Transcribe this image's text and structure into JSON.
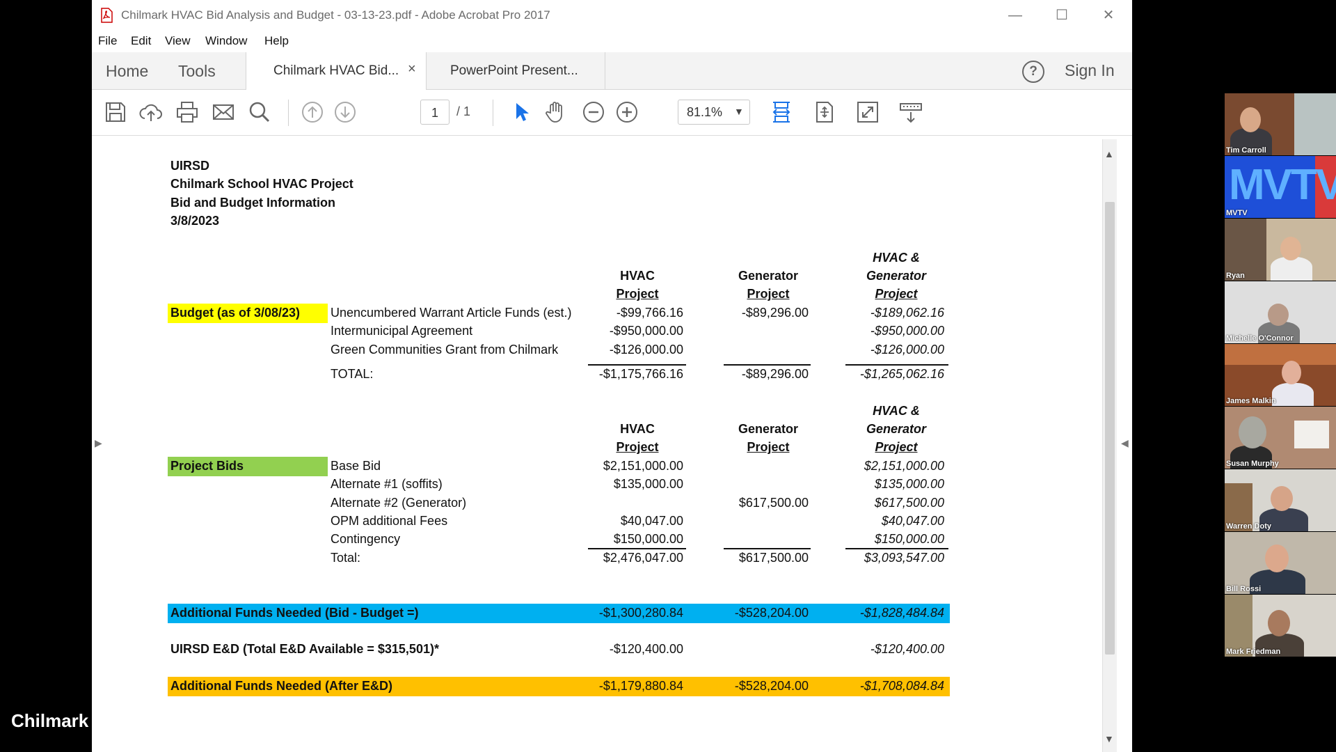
{
  "window": {
    "title": "Chilmark HVAC Bid Analysis and Budget - 03-13-23.pdf - Adobe Acrobat Pro 2017",
    "minimize": "—",
    "maximize": "☐",
    "close": "✕"
  },
  "menu": [
    "File",
    "Edit",
    "View",
    "Window",
    "Help"
  ],
  "tabs": {
    "home": "Home",
    "tools": "Tools",
    "active_doc": "Chilmark HVAC Bid...",
    "close": "×",
    "other_doc": "PowerPoint Present...",
    "help": "?",
    "sign_in": "Sign In"
  },
  "toolbar": {
    "page_current": "1",
    "page_total": "/ 1",
    "zoom": "81.1%",
    "icons": [
      "save-icon",
      "upload-icon",
      "print-icon",
      "email-icon",
      "search-icon",
      "page-up-icon",
      "page-down-icon",
      "select-arrow-icon",
      "hand-icon",
      "zoom-out-icon",
      "zoom-in-icon",
      "fit-width-icon",
      "fit-page-icon",
      "fullscreen-icon",
      "read-mode-icon"
    ]
  },
  "document": {
    "header": [
      "UIRSD",
      "Chilmark School HVAC Project",
      "Bid and Budget Information",
      "3/8/2023"
    ],
    "col_headers": {
      "hvac": [
        "HVAC",
        "Project"
      ],
      "generator": [
        "Generator",
        "Project"
      ],
      "combined": [
        "HVAC &",
        "Generator",
        "Project"
      ]
    },
    "budget": {
      "label": "Budget (as of 3/08/23)",
      "label_color": "#ffff00",
      "rows": [
        {
          "item": "Unencumbered Warrant Article Funds (est.)",
          "hvac": "-$99,766.16",
          "gen": "-$89,296.00",
          "combined": "-$189,062.16"
        },
        {
          "item": "Intermunicipal Agreement",
          "hvac": "-$950,000.00",
          "gen": "",
          "combined": "-$950,000.00"
        },
        {
          "item": "Green Communities Grant from Chilmark",
          "hvac": "-$126,000.00",
          "gen": "",
          "combined": "-$126,000.00"
        }
      ],
      "total": {
        "item": "TOTAL:",
        "hvac": "-$1,175,766.16",
        "gen": "-$89,296.00",
        "combined": "-$1,265,062.16"
      }
    },
    "bids": {
      "label": "Project Bids",
      "label_color": "#92d050",
      "rows": [
        {
          "item": "Base Bid",
          "hvac": "$2,151,000.00",
          "gen": "",
          "combined": "$2,151,000.00"
        },
        {
          "item": "Alternate #1 (soffits)",
          "hvac": "$135,000.00",
          "gen": "",
          "combined": "$135,000.00"
        },
        {
          "item": "Alternate #2 (Generator)",
          "hvac": "",
          "gen": "$617,500.00",
          "combined": "$617,500.00"
        },
        {
          "item": "OPM additional Fees",
          "hvac": "$40,047.00",
          "gen": "",
          "combined": "$40,047.00"
        },
        {
          "item": "Contingency",
          "hvac": "$150,000.00",
          "gen": "",
          "combined": "$150,000.00"
        }
      ],
      "total": {
        "item": "Total:",
        "hvac": "$2,476,047.00",
        "gen": "$617,500.00",
        "combined": "$3,093,547.00"
      }
    },
    "additional": {
      "label": "Additional Funds Needed (Bid - Budget =)",
      "color": "#00b0f0",
      "hvac": "-$1,300,280.84",
      "gen": "-$528,204.00",
      "combined": "-$1,828,484.84"
    },
    "ed": {
      "label": "UIRSD E&D (Total E&D Available = $315,501)*",
      "hvac": "-$120,400.00",
      "gen": "",
      "combined": "-$120,400.00"
    },
    "after_ed": {
      "label": "Additional Funds Needed (After E&D)",
      "color": "#ffc000",
      "hvac": "-$1,179,880.84",
      "gen": "-$528,204.00",
      "combined": "-$1,708,084.84"
    }
  },
  "participants": [
    "Tim Carroll",
    "MVTV",
    "Ryan",
    "Michelle O'Connor",
    "James Malkin",
    "Susan Murphy",
    "Warren Doty",
    "Bill Rossi",
    "Mark Friedman"
  ],
  "mvtv_logo": "MVTV",
  "watermark": "Chilmark B"
}
